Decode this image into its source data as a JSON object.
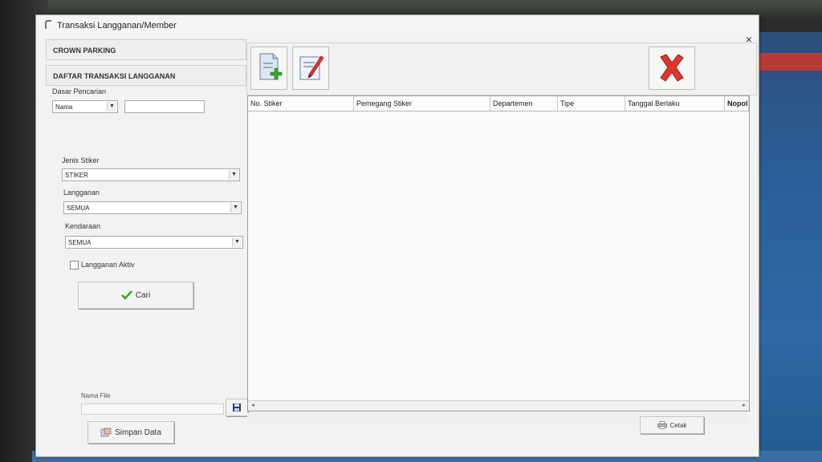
{
  "window": {
    "title": "Transaksi Langganan/Member",
    "close_glyph": "×"
  },
  "left": {
    "header1": "CROWN PARKING",
    "header2": "DAFTAR TRANSAKSI LANGGANAN",
    "search_basis_label": "Dasar Pencarian",
    "search_basis_value": "Nama",
    "search_text_value": "",
    "sticker_type_label": "Jenis Stiker",
    "sticker_type_value": "STIKER",
    "subscription_label": "Langganan",
    "subscription_value": "SEMUA",
    "vehicle_label": "Kendaraan",
    "vehicle_value": "SEMUA",
    "active_label": "Langganan Aktiv",
    "active_checked": false,
    "search_button": "Cari",
    "file_name_label": "Nama File",
    "file_name_value": "",
    "save_button": "Simpan Data"
  },
  "toolbar": {
    "icons": [
      "new-document-icon",
      "edit-document-icon",
      "delete-icon"
    ],
    "accent_green": "#3aa335",
    "accent_red": "#e0352b"
  },
  "grid": {
    "columns": [
      "No. Stiker",
      "Pemegang Stiker",
      "Departemen",
      "Tipe",
      "Tanggal Berlaku",
      "Nopol"
    ],
    "rows": []
  },
  "footer": {
    "print_button": "Cetak"
  }
}
